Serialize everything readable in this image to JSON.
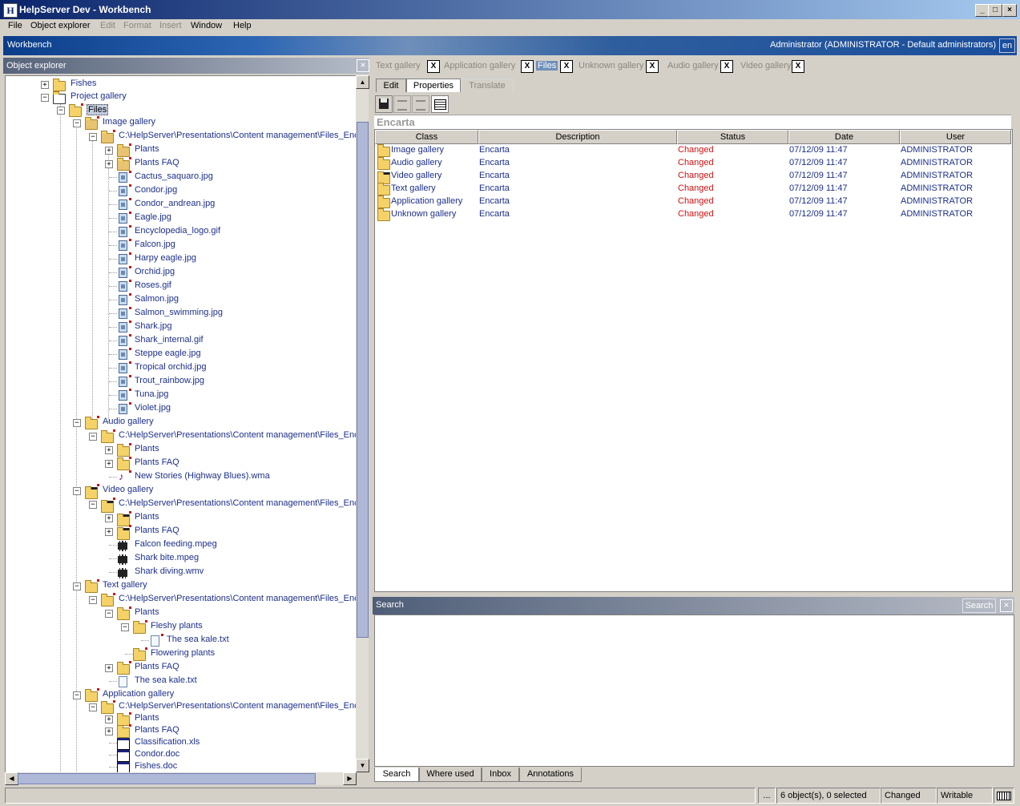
{
  "window": {
    "title": "HelpServer Dev - Workbench",
    "icon_glyph": "H",
    "minimize": "_",
    "maximize": "□",
    "close": "×"
  },
  "menu": [
    {
      "label": "File",
      "enabled": true
    },
    {
      "label": "Object explorer",
      "enabled": true
    },
    {
      "label": "Edit",
      "enabled": false
    },
    {
      "label": "Format",
      "enabled": false
    },
    {
      "label": "Insert",
      "enabled": false
    },
    {
      "label": "Window",
      "enabled": true
    },
    {
      "label": "Help",
      "enabled": true
    }
  ],
  "workbench": {
    "title": "Workbench",
    "user": "Administrator (ADMINISTRATOR - Default administrators)",
    "language": "en"
  },
  "object_explorer": {
    "title": "Object explorer",
    "close": "×"
  },
  "tree": [
    {
      "label": "Fishes",
      "level": 2,
      "icon": "folder",
      "expander": "+"
    },
    {
      "label": "Project gallery",
      "level": 2,
      "icon": "project-icon",
      "expander": "−"
    },
    {
      "label": "Files",
      "level": 3,
      "icon": "folder",
      "expander": "−",
      "selected": true,
      "marked": true
    },
    {
      "label": "Image gallery",
      "level": 4,
      "icon": "image-folder",
      "expander": "−",
      "marked": true
    },
    {
      "label": "C:\\HelpServer\\Presentations\\Content management\\Files_Ency",
      "level": 5,
      "icon": "image-folder",
      "expander": "−",
      "marked": true
    },
    {
      "label": "Plants",
      "level": 6,
      "icon": "image-folder",
      "expander": "+",
      "marked": true
    },
    {
      "label": "Plants FAQ",
      "level": 6,
      "icon": "image-folder",
      "expander": "+",
      "marked": true
    },
    {
      "label": "Cactus_saquaro.jpg",
      "level": 6,
      "icon": "image",
      "marked": true
    },
    {
      "label": "Condor.jpg",
      "level": 6,
      "icon": "image",
      "marked": true
    },
    {
      "label": "Condor_andrean.jpg",
      "level": 6,
      "icon": "image",
      "marked": true
    },
    {
      "label": "Eagle.jpg",
      "level": 6,
      "icon": "image",
      "marked": true
    },
    {
      "label": "Encyclopedia_logo.gif",
      "level": 6,
      "icon": "image",
      "marked": true
    },
    {
      "label": "Falcon.jpg",
      "level": 6,
      "icon": "image",
      "marked": true
    },
    {
      "label": "Harpy eagle.jpg",
      "level": 6,
      "icon": "image",
      "marked": true
    },
    {
      "label": "Orchid.jpg",
      "level": 6,
      "icon": "image",
      "marked": true
    },
    {
      "label": "Roses.gif",
      "level": 6,
      "icon": "image",
      "marked": true
    },
    {
      "label": "Salmon.jpg",
      "level": 6,
      "icon": "image",
      "marked": true
    },
    {
      "label": "Salmon_swimming.jpg",
      "level": 6,
      "icon": "image",
      "marked": true
    },
    {
      "label": "Shark.jpg",
      "level": 6,
      "icon": "image",
      "marked": true
    },
    {
      "label": "Shark_internal.gif",
      "level": 6,
      "icon": "image",
      "marked": true
    },
    {
      "label": "Steppe eagle.jpg",
      "level": 6,
      "icon": "image",
      "marked": true
    },
    {
      "label": "Tropical orchid.jpg",
      "level": 6,
      "icon": "image",
      "marked": true
    },
    {
      "label": "Trout_rainbow.jpg",
      "level": 6,
      "icon": "image",
      "marked": true
    },
    {
      "label": "Tuna.jpg",
      "level": 6,
      "icon": "image",
      "marked": true
    },
    {
      "label": "Violet.jpg",
      "level": 6,
      "icon": "image",
      "marked": true
    },
    {
      "label": "Audio gallery",
      "level": 4,
      "icon": "audio-folder",
      "expander": "−",
      "marked": true
    },
    {
      "label": "C:\\HelpServer\\Presentations\\Content management\\Files_Ency",
      "level": 5,
      "icon": "audio-folder",
      "expander": "−",
      "marked": true
    },
    {
      "label": "Plants",
      "level": 6,
      "icon": "audio-folder",
      "expander": "+",
      "marked": true
    },
    {
      "label": "Plants FAQ",
      "level": 6,
      "icon": "audio-folder",
      "expander": "+",
      "marked": true
    },
    {
      "label": "New Stories (Highway Blues).wma",
      "level": 6,
      "icon": "audio",
      "marked": true
    },
    {
      "label": "Video gallery",
      "level": 4,
      "icon": "video-folder",
      "expander": "−",
      "marked": true
    },
    {
      "label": "C:\\HelpServer\\Presentations\\Content management\\Files_Ency",
      "level": 5,
      "icon": "video-folder",
      "expander": "−",
      "marked": true
    },
    {
      "label": "Plants",
      "level": 6,
      "icon": "video-folder",
      "expander": "+",
      "marked": true
    },
    {
      "label": "Plants FAQ",
      "level": 6,
      "icon": "video-folder",
      "expander": "+",
      "marked": true
    },
    {
      "label": "Falcon feeding.mpeg",
      "level": 6,
      "icon": "video",
      "marked": false
    },
    {
      "label": "Shark bite.mpeg",
      "level": 6,
      "icon": "video",
      "marked": false
    },
    {
      "label": "Shark diving.wmv",
      "level": 6,
      "icon": "video",
      "marked": false
    },
    {
      "label": "Text gallery",
      "level": 4,
      "icon": "text-folder",
      "expander": "−",
      "marked": true
    },
    {
      "label": "C:\\HelpServer\\Presentations\\Content management\\Files_Ency",
      "level": 5,
      "icon": "text-folder",
      "expander": "−",
      "marked": true
    },
    {
      "label": "Plants",
      "level": 6,
      "icon": "text-folder",
      "expander": "−",
      "marked": true
    },
    {
      "label": "Fleshy plants",
      "level": 7,
      "icon": "text-folder",
      "expander": "−",
      "marked": true
    },
    {
      "label": "The sea kale.txt",
      "level": 8,
      "icon": "text",
      "marked": true
    },
    {
      "label": "Flowering plants",
      "level": 7,
      "icon": "text-folder",
      "marked": true
    },
    {
      "label": "Plants FAQ",
      "level": 6,
      "icon": "text-folder",
      "expander": "+",
      "marked": true
    },
    {
      "label": "The sea kale.txt",
      "level": 6,
      "icon": "text",
      "marked": false
    },
    {
      "label": "Application gallery",
      "level": 4,
      "icon": "app-folder",
      "expander": "−",
      "marked": true
    },
    {
      "label": "C:\\HelpServer\\Presentations\\Content management\\Files_Ency",
      "level": 5,
      "icon": "app-folder",
      "expander": "−",
      "marked": true
    },
    {
      "label": "Plants",
      "level": 6,
      "icon": "app-folder",
      "expander": "+",
      "marked": true
    },
    {
      "label": "Plants FAQ",
      "level": 6,
      "icon": "app-folder",
      "expander": "+",
      "marked": true
    },
    {
      "label": "Classification.xls",
      "level": 6,
      "icon": "document",
      "marked": false
    },
    {
      "label": "Condor.doc",
      "level": 6,
      "icon": "document",
      "marked": false
    },
    {
      "label": "Fishes.doc",
      "level": 6,
      "icon": "document",
      "marked": false
    }
  ],
  "doc_tabs": [
    {
      "label": "Text gallery",
      "active": false
    },
    {
      "label": "Application gallery",
      "active": false
    },
    {
      "label": "Files",
      "active": true
    },
    {
      "label": "Unknown gallery",
      "active": false
    },
    {
      "label": "Audio gallery",
      "active": false
    },
    {
      "label": "Video gallery",
      "active": false
    }
  ],
  "tab_close_glyph": "X",
  "sub_tabs": [
    {
      "label": "Edit",
      "state": "normal"
    },
    {
      "label": "Properties",
      "state": "active"
    },
    {
      "label": "Translate",
      "state": "disabled"
    }
  ],
  "toolbar": [
    "save-icon",
    "indent-icon",
    "outdent-icon",
    "table-icon"
  ],
  "section_title": "Encarta",
  "grid": {
    "columns": [
      "Class",
      "Description",
      "Status",
      "Date",
      "User"
    ],
    "rows": [
      {
        "class": "Image gallery",
        "icon": "image-folder",
        "description": "Encarta",
        "status": "Changed",
        "date": "07/12/09 11:47",
        "user": "ADMINISTRATOR"
      },
      {
        "class": "Audio gallery",
        "icon": "audio-folder",
        "description": "Encarta",
        "status": "Changed",
        "date": "07/12/09 11:47",
        "user": "ADMINISTRATOR"
      },
      {
        "class": "Video gallery",
        "icon": "video-folder",
        "description": "Encarta",
        "status": "Changed",
        "date": "07/12/09 11:47",
        "user": "ADMINISTRATOR"
      },
      {
        "class": "Text gallery",
        "icon": "text-folder",
        "description": "Encarta",
        "status": "Changed",
        "date": "07/12/09 11:47",
        "user": "ADMINISTRATOR"
      },
      {
        "class": "Application gallery",
        "icon": "app-folder",
        "description": "Encarta",
        "status": "Changed",
        "date": "07/12/09 11:47",
        "user": "ADMINISTRATOR"
      },
      {
        "class": "Unknown gallery",
        "icon": "folder",
        "description": "Encarta",
        "status": "Changed",
        "date": "07/12/09 11:47",
        "user": "ADMINISTRATOR"
      }
    ]
  },
  "search_panel": {
    "title": "Search",
    "button": "Search",
    "close": "×"
  },
  "bottom_tabs": [
    "Search",
    "Where used",
    "Inbox",
    "Annotations"
  ],
  "status_bar": {
    "ellipsis": "...",
    "selection": "6 object(s), 0 selected",
    "state": "Changed",
    "mode": "Writable"
  },
  "colors": {
    "tree_text": "#1c2f8a",
    "changed_status": "#d01010",
    "marker": "#d01010",
    "title_gradient_start": "#0a246a"
  }
}
